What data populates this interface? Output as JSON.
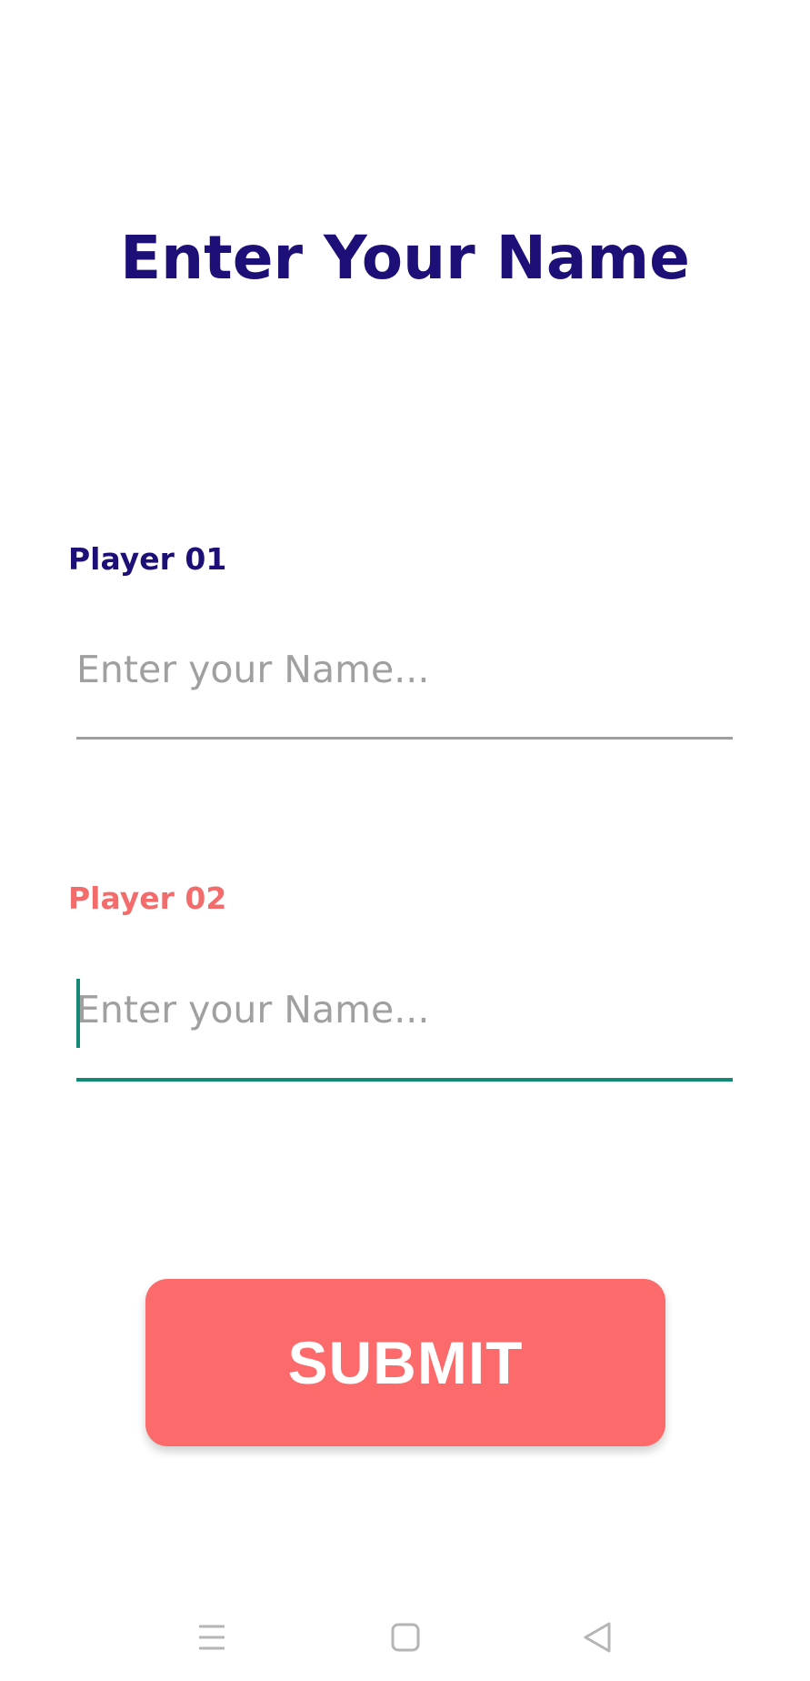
{
  "page": {
    "title": "Enter Your Name"
  },
  "form": {
    "player1": {
      "label": "Player 01",
      "placeholder": "Enter your Name...",
      "value": ""
    },
    "player2": {
      "label": "Player 02",
      "placeholder": "Enter your Name...",
      "value": "",
      "focused": true
    },
    "submit_label": "SUBMIT"
  },
  "navigation": {
    "buttons": [
      "menu-icon",
      "home-icon",
      "back-icon"
    ]
  },
  "colors": {
    "title": "#1c0f78",
    "label_default": "#1c0f78",
    "label_focused": "#f46b6b",
    "accent": "#138a78",
    "button": "#fd6a6b",
    "placeholder": "#a0a0a0",
    "underline_idle": "#9e9e9e",
    "nav_icon": "#b5b5b5"
  }
}
